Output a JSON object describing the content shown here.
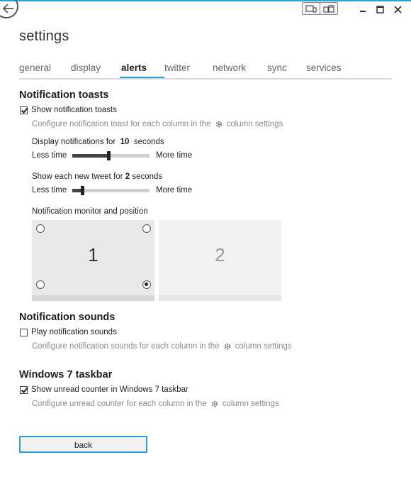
{
  "window": {
    "title": "settings",
    "accent_color": "#2aa0d8",
    "controls": {
      "view_icons": [
        "tablet-icon",
        "dual-screen-icon"
      ],
      "minimize": "minimize-icon",
      "maximize": "maximize-icon",
      "close": "close-icon"
    }
  },
  "tabs": [
    {
      "label": "general",
      "active": false
    },
    {
      "label": "display",
      "active": false
    },
    {
      "label": "alerts",
      "active": true
    },
    {
      "label": "twitter",
      "active": false
    },
    {
      "label": "network",
      "active": false
    },
    {
      "label": "sync",
      "active": false
    },
    {
      "label": "services",
      "active": false
    }
  ],
  "toasts": {
    "heading": "Notification toasts",
    "show_label": "Show notification toasts",
    "show_checked": true,
    "hint_before": "Configure notification toast for each column in the",
    "hint_after": "column settings",
    "display_for_prefix": "Display notifications for",
    "display_for_value": "10",
    "display_for_suffix": "seconds",
    "slider1": {
      "less": "Less time",
      "more": "More time",
      "level": 0.47
    },
    "tweet_prefix": "Show each new tweet for",
    "tweet_value": "2",
    "tweet_suffix": "seconds",
    "slider2": {
      "less": "Less time",
      "more": "More time",
      "level": 0.13
    },
    "monitor_label": "Notification monitor and position",
    "monitors": [
      {
        "number": "1",
        "selected_corner": "bottom-right"
      },
      {
        "number": "2"
      }
    ]
  },
  "sounds": {
    "heading": "Notification sounds",
    "play_label": "Play notification sounds",
    "play_checked": false,
    "hint_before": "Configure notification sounds for each column in the",
    "hint_after": "column settings"
  },
  "taskbar": {
    "heading": "Windows 7 taskbar",
    "show_label": "Show unread counter in Windows 7 taskbar",
    "show_checked": true,
    "hint_before": "Configure unread counter for each column in the",
    "hint_after": "column settings"
  },
  "footer": {
    "back_label": "back"
  }
}
